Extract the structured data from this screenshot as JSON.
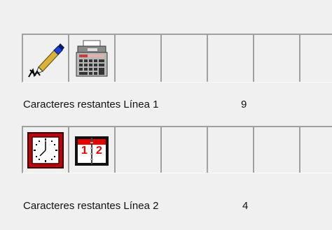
{
  "rows": [
    {
      "cells": [
        {
          "icon": "pen-signature-icon"
        },
        {
          "icon": "adding-machine-icon"
        },
        {
          "icon": ""
        },
        {
          "icon": ""
        },
        {
          "icon": ""
        },
        {
          "icon": ""
        },
        {
          "icon": ""
        }
      ],
      "label": "Caracteres restantes Línea 1",
      "remaining": "9"
    },
    {
      "cells": [
        {
          "icon": "wall-clock-icon"
        },
        {
          "icon": "calendar-book-icon"
        },
        {
          "icon": ""
        },
        {
          "icon": ""
        },
        {
          "icon": ""
        },
        {
          "icon": ""
        },
        {
          "icon": ""
        }
      ],
      "label": "Caracteres restantes Línea 2",
      "remaining": "4"
    }
  ],
  "icon_glyphs": {
    "calendar_left": "1",
    "calendar_right": "2"
  },
  "colors": {
    "background": "#f0f0f0",
    "grid_line": "#a0a0a0",
    "clock_frame": "#c0000a",
    "calendar_red": "#e60000",
    "pen_blue": "#1c3fd8",
    "pen_gold": "#d8b23a"
  }
}
